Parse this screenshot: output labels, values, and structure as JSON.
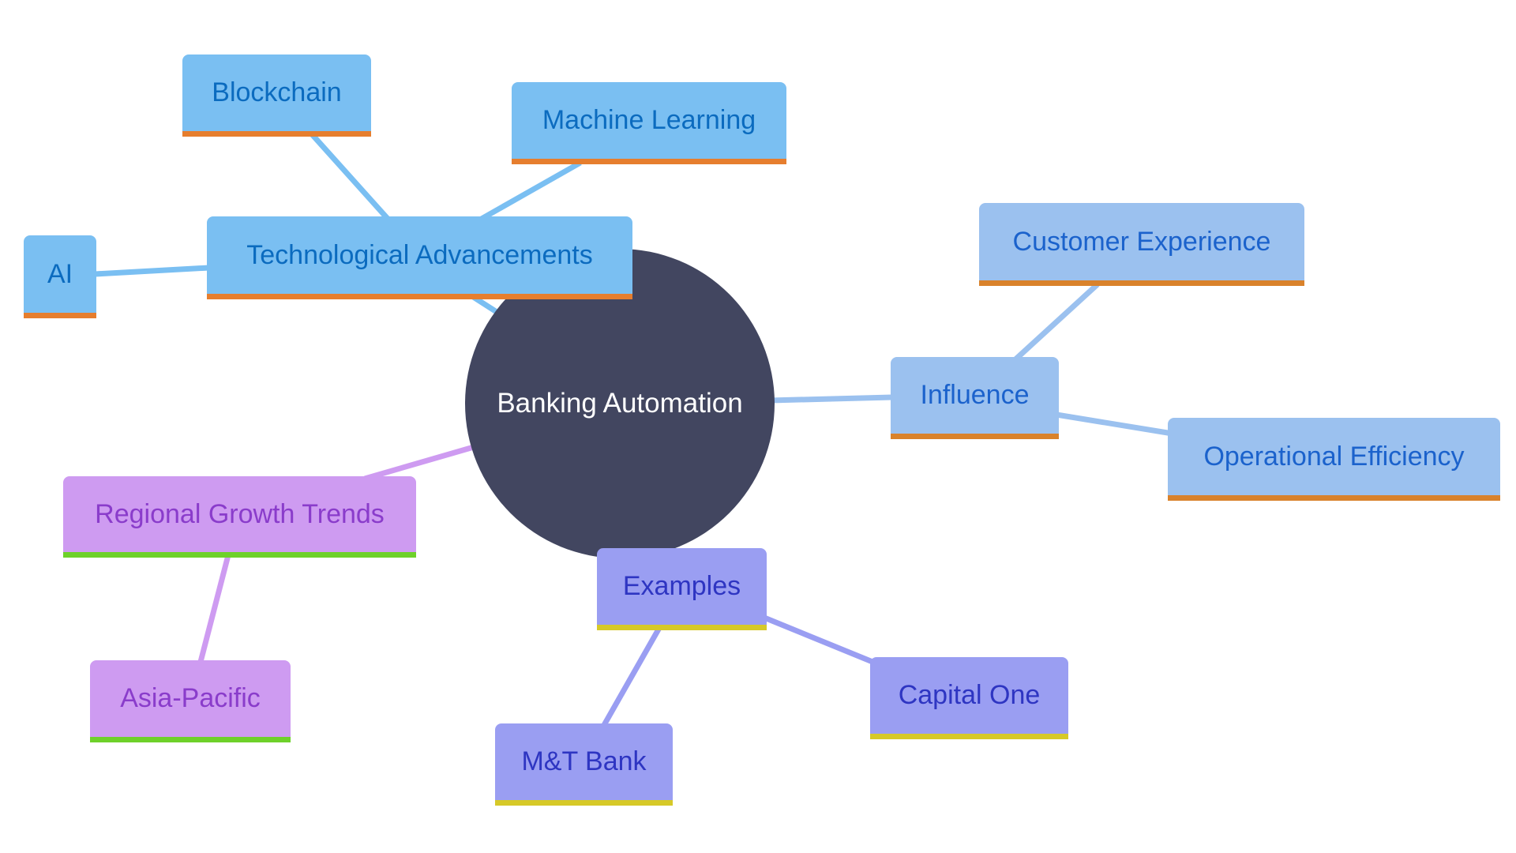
{
  "diagram": {
    "type": "mindmap",
    "root": {
      "label": "Banking Automation",
      "color": "#424660"
    },
    "branches": [
      {
        "id": "tech",
        "label": "Technological Advancements",
        "fill": "#7ABFF2",
        "text": "#0B6BBF",
        "accent": "#E67E2E",
        "edge": "#7ABFF2",
        "children": [
          {
            "id": "blockchain",
            "label": "Blockchain"
          },
          {
            "id": "ml",
            "label": "Machine Learning"
          },
          {
            "id": "ai",
            "label": "AI"
          }
        ]
      },
      {
        "id": "influence",
        "label": "Influence",
        "fill": "#9BC1EF",
        "text": "#1B62CC",
        "accent": "#D9822B",
        "edge": "#9BC1EF",
        "children": [
          {
            "id": "cx",
            "label": "Customer Experience"
          },
          {
            "id": "opeff",
            "label": "Operational Efficiency"
          }
        ]
      },
      {
        "id": "examples",
        "label": "Examples",
        "fill": "#9A9EF2",
        "text": "#2E35C2",
        "accent": "#D6C928",
        "edge": "#9A9EF2",
        "children": [
          {
            "id": "capone",
            "label": "Capital One"
          },
          {
            "id": "mt",
            "label": "M&T Bank"
          }
        ]
      },
      {
        "id": "regional",
        "label": "Regional Growth Trends",
        "fill": "#CE9BF1",
        "text": "#8A3CCB",
        "accent": "#6ED12A",
        "edge": "#CE9BF1",
        "children": [
          {
            "id": "apac",
            "label": "Asia-Pacific"
          }
        ]
      }
    ]
  }
}
